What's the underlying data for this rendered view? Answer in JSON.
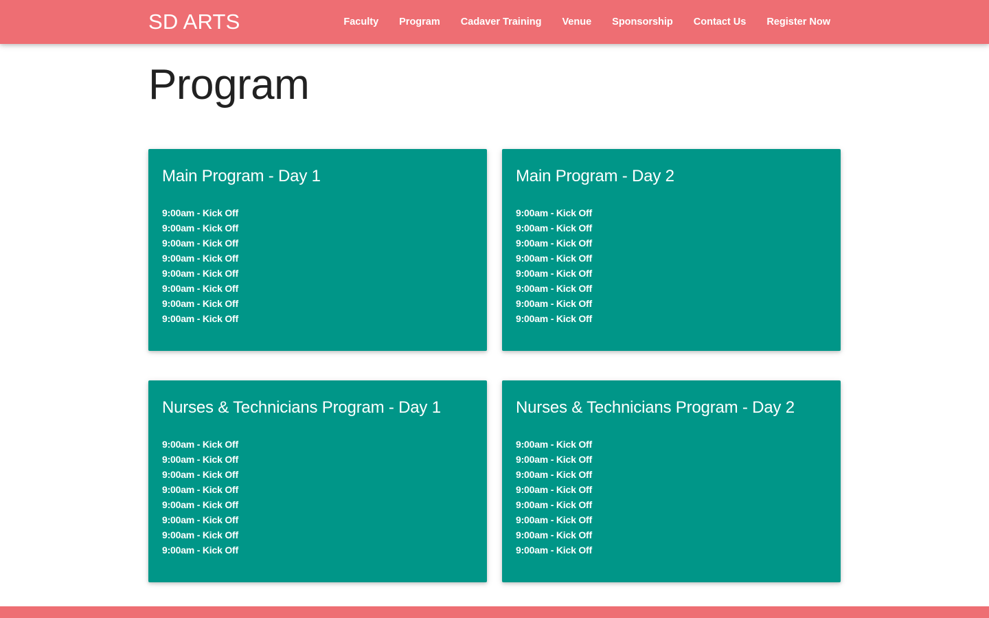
{
  "brand": "SD ARTS",
  "nav": [
    {
      "label": "Faculty"
    },
    {
      "label": "Program"
    },
    {
      "label": "Cadaver Training"
    },
    {
      "label": "Venue"
    },
    {
      "label": "Sponsorship"
    },
    {
      "label": "Contact Us"
    },
    {
      "label": "Register Now"
    }
  ],
  "page_title": "Program",
  "cards": [
    {
      "title": "Main Program - Day 1",
      "items": [
        "9:00am - Kick Off",
        "9:00am - Kick Off",
        "9:00am - Kick Off",
        "9:00am - Kick Off",
        "9:00am - Kick Off",
        "9:00am - Kick Off",
        "9:00am - Kick Off",
        "9:00am - Kick Off"
      ]
    },
    {
      "title": "Main Program - Day 2",
      "items": [
        "9:00am - Kick Off",
        "9:00am - Kick Off",
        "9:00am - Kick Off",
        "9:00am - Kick Off",
        "9:00am - Kick Off",
        "9:00am - Kick Off",
        "9:00am - Kick Off",
        "9:00am - Kick Off"
      ]
    },
    {
      "title": "Nurses & Technicians Program - Day 1",
      "items": [
        "9:00am - Kick Off",
        "9:00am - Kick Off",
        "9:00am - Kick Off",
        "9:00am - Kick Off",
        "9:00am - Kick Off",
        "9:00am - Kick Off",
        "9:00am - Kick Off",
        "9:00am - Kick Off"
      ]
    },
    {
      "title": "Nurses & Technicians Program - Day 2",
      "items": [
        "9:00am - Kick Off",
        "9:00am - Kick Off",
        "9:00am - Kick Off",
        "9:00am - Kick Off",
        "9:00am - Kick Off",
        "9:00am - Kick Off",
        "9:00am - Kick Off",
        "9:00am - Kick Off"
      ]
    }
  ],
  "colors": {
    "nav_background": "#ee6e73",
    "card_background": "#009688",
    "footer_background": "#ee6e73",
    "title_text": "#212121"
  }
}
